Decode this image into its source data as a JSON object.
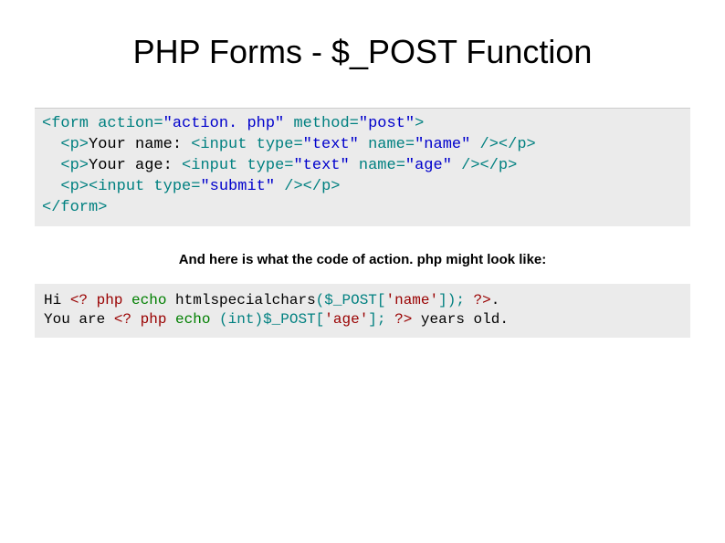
{
  "title": "PHP Forms - $_POST Function",
  "code1": {
    "l1a": "<form action=",
    "l1b": "\"action. php\"",
    "l1c": " method=",
    "l1d": "\"post\"",
    "l1e": ">",
    "l2a": "  <p>",
    "l2b": "Your name: ",
    "l2c": "<input type=",
    "l2d": "\"text\"",
    "l2e": " name=",
    "l2f": "\"name\"",
    "l2g": " /></p>",
    "l3a": "  <p>",
    "l3b": "Your age: ",
    "l3c": "<input type=",
    "l3d": "\"text\"",
    "l3e": " name=",
    "l3f": "\"age\"",
    "l3g": " /></p>",
    "l4a": "  <p><input type=",
    "l4b": "\"submit\"",
    "l4c": " /></p>",
    "l5": "</form>"
  },
  "caption": "And here is what the code of action. php might look like:",
  "code2": {
    "l1a": "Hi ",
    "l1b": "<? php ",
    "l1c": "echo ",
    "l1d": "htmlspecialchars",
    "l1e": "(",
    "l1f": "$_POST",
    "l1g": "[",
    "l1h": "'name'",
    "l1i": "]); ",
    "l1j": "?>",
    "l1k": ".",
    "l2a": "You are ",
    "l2b": "<? php ",
    "l2c": "echo ",
    "l2d": "(int)",
    "l2e": "$_POST",
    "l2f": "[",
    "l2g": "'age'",
    "l2h": "]; ",
    "l2i": "?>",
    "l2j": " years old."
  }
}
